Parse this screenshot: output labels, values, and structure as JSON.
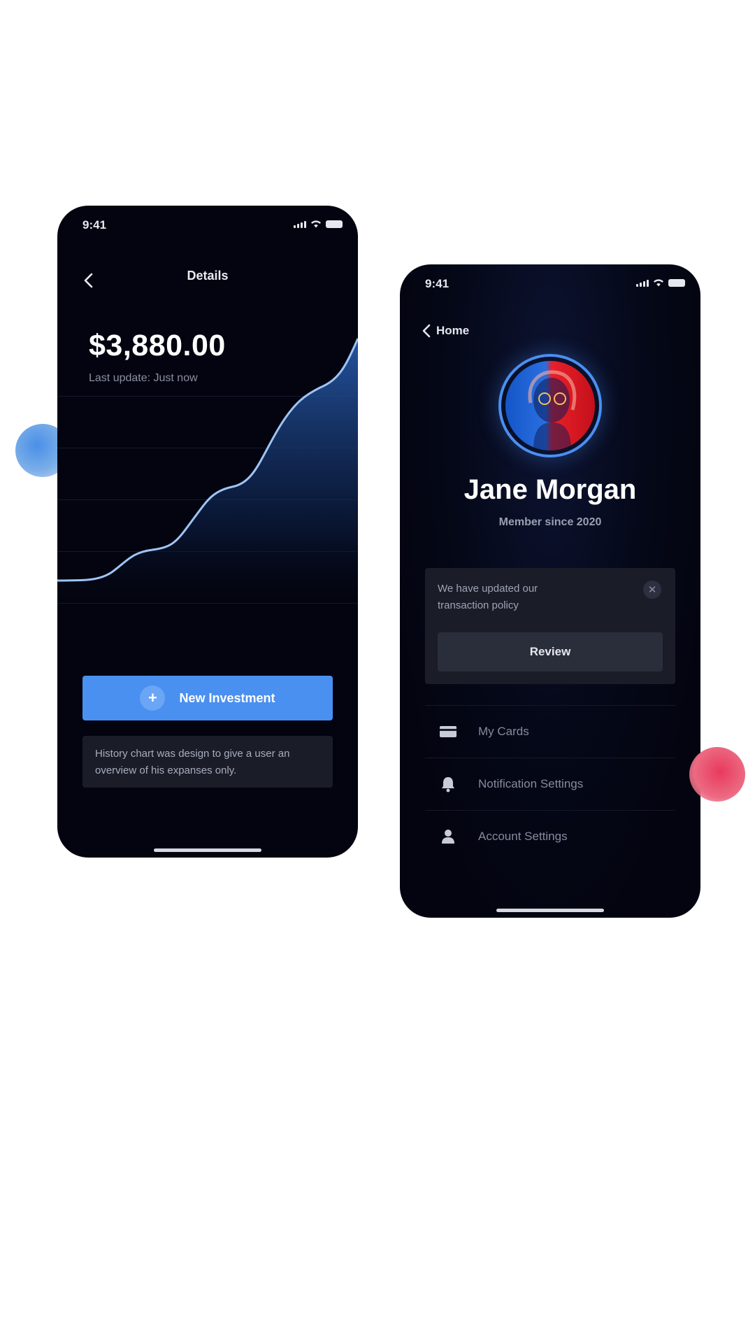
{
  "left_phone": {
    "status_time": "9:41",
    "nav_title": "Details",
    "balance": "$3,880.00",
    "last_update": "Last update: Just now",
    "new_investment_label": "New Investment",
    "plus_symbol": "+",
    "info_text": "History chart was design to give a user an overview of his expanses only."
  },
  "right_phone": {
    "status_time": "9:41",
    "back_label": "Home",
    "user_name": "Jane Morgan",
    "member_since": "Member since 2020",
    "notice_text": "We have updated our transaction policy",
    "close_symbol": "✕",
    "review_label": "Review",
    "menu_items": [
      {
        "label": "My Cards",
        "icon": "card-icon"
      },
      {
        "label": "Notification Settings",
        "icon": "bell-icon"
      },
      {
        "label": "Account Settings",
        "icon": "user-icon"
      }
    ]
  },
  "colors": {
    "accent_blue": "#4a90f0",
    "phone_bg": "#03040f",
    "blob_red": "#e83a5c"
  }
}
